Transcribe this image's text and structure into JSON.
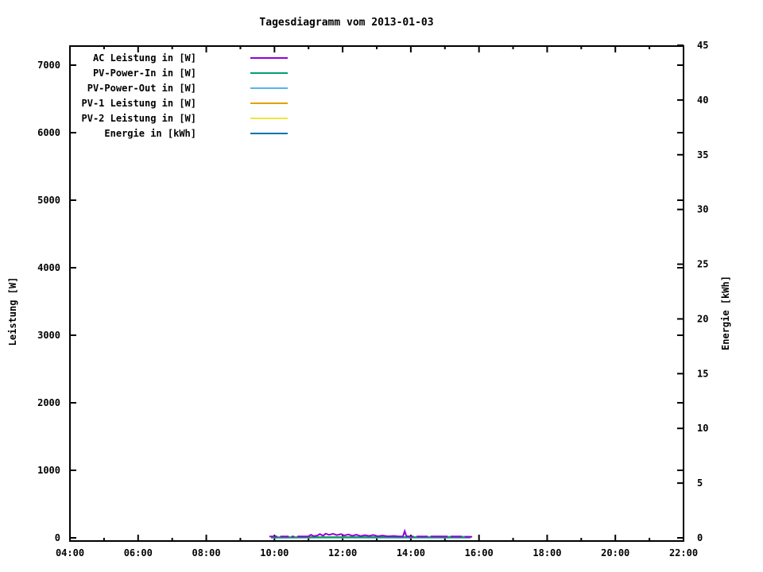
{
  "chart_data": {
    "type": "line",
    "title": "Tagesdiagramm vom 2013-01-03",
    "grid": false,
    "legend_position": "top-left-inside",
    "x": {
      "min_hour": 4,
      "max_hour": 22,
      "major_step_hours": 2,
      "minor_step_hours": 1,
      "tick_labels": [
        "04:00",
        "06:00",
        "08:00",
        "10:00",
        "12:00",
        "14:00",
        "16:00",
        "18:00",
        "20:00",
        "22:00"
      ]
    },
    "y1": {
      "label": "Leistung [W]",
      "min": 0,
      "max": 7000,
      "tick_step": 1000,
      "tick_labels": [
        "0",
        "1000",
        "2000",
        "3000",
        "4000",
        "5000",
        "6000",
        "7000"
      ]
    },
    "y2": {
      "label": "Energie [kWh]",
      "min": 0,
      "max": 45,
      "tick_step": 5,
      "tick_labels": [
        "0",
        "5",
        "10",
        "15",
        "20",
        "25",
        "30",
        "35",
        "40",
        "45"
      ]
    },
    "series": [
      {
        "name": "AC Leistung in [W]",
        "color": "#9400d3",
        "axis": "y1",
        "segments": [
          [
            [
              9.85,
              20
            ],
            [
              10.08,
              20
            ]
          ],
          [
            [
              10.17,
              20
            ],
            [
              10.42,
              20
            ]
          ],
          [
            [
              10.5,
              20
            ],
            [
              10.58,
              20
            ]
          ],
          [
            [
              10.67,
              20
            ],
            [
              11.0,
              22
            ],
            [
              11.07,
              45
            ],
            [
              11.15,
              25
            ],
            [
              11.25,
              32
            ],
            [
              11.33,
              55
            ],
            [
              11.43,
              32
            ],
            [
              11.5,
              62
            ],
            [
              11.6,
              45
            ],
            [
              11.72,
              60
            ],
            [
              11.83,
              40
            ],
            [
              11.95,
              55
            ],
            [
              12.05,
              35
            ],
            [
              12.17,
              50
            ],
            [
              12.28,
              30
            ],
            [
              12.4,
              46
            ],
            [
              12.53,
              26
            ],
            [
              12.65,
              40
            ],
            [
              12.78,
              28
            ],
            [
              12.9,
              42
            ],
            [
              13.03,
              24
            ],
            [
              13.17,
              34
            ],
            [
              13.33,
              22
            ],
            [
              13.5,
              28
            ],
            [
              13.65,
              20
            ],
            [
              13.77,
              22
            ],
            [
              13.82,
              100
            ],
            [
              13.87,
              25
            ],
            [
              13.95,
              20
            ],
            [
              14.08,
              20
            ]
          ],
          [
            [
              14.17,
              20
            ],
            [
              14.5,
              20
            ]
          ],
          [
            [
              14.58,
              20
            ],
            [
              15.08,
              20
            ]
          ],
          [
            [
              15.17,
              20
            ],
            [
              15.5,
              20
            ]
          ],
          [
            [
              15.58,
              15
            ],
            [
              15.8,
              15
            ]
          ]
        ]
      },
      {
        "name": "PV-Power-In in [W]",
        "color": "#009e73",
        "axis": "y1",
        "segments": [
          [
            [
              9.9,
              6
            ],
            [
              12.0,
              8
            ],
            [
              15.75,
              6
            ]
          ]
        ]
      },
      {
        "name": "PV-Power-Out in [W]",
        "color": "#56b4e9",
        "axis": "y1",
        "segments": [
          [
            [
              9.9,
              3
            ],
            [
              15.75,
              3
            ]
          ]
        ]
      },
      {
        "name": "PV-1 Leistung in [W]",
        "color": "#e69f00",
        "axis": "y1",
        "segments": [
          [
            [
              9.9,
              10
            ],
            [
              11.5,
              12
            ],
            [
              13.0,
              10
            ],
            [
              15.7,
              8
            ]
          ]
        ]
      },
      {
        "name": "PV-2 Leistung in [W]",
        "color": "#f0e442",
        "axis": "y1",
        "segments": [
          [
            [
              9.9,
              5
            ],
            [
              15.7,
              5
            ]
          ]
        ]
      },
      {
        "name": "Energie in [kWh]",
        "color": "#0072b2",
        "axis": "y2",
        "segments": [
          [
            [
              9.9,
              0.02
            ],
            [
              15.75,
              0.1
            ]
          ]
        ]
      }
    ]
  }
}
